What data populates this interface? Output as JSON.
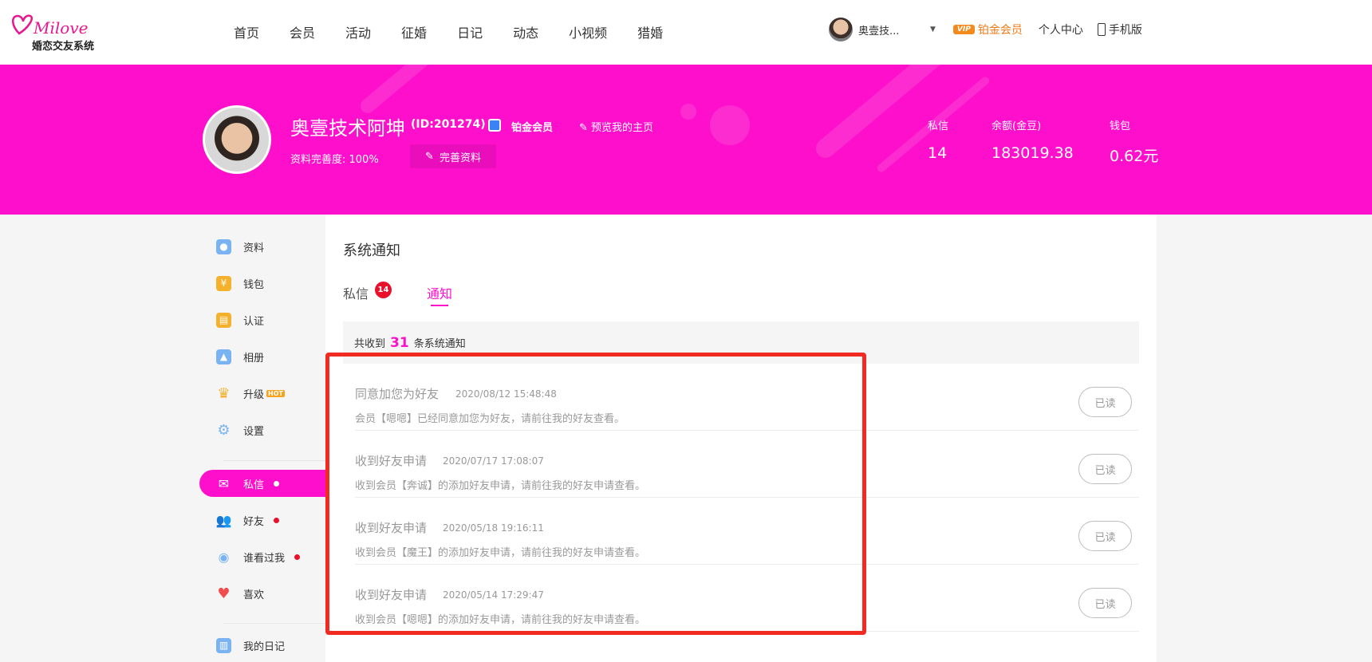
{
  "logo": {
    "script": "Milove",
    "subtitle": "婚恋交友系统"
  },
  "nav": [
    "首页",
    "会员",
    "活动",
    "征婚",
    "日记",
    "动态",
    "小视频",
    "猎婚"
  ],
  "user": {
    "name": "奥壹技...",
    "vip_badge": "VIP",
    "vip_level": "铂金会员",
    "center_link": "个人中心",
    "mobile_link": "手机版"
  },
  "profile": {
    "name": "奥壹技术阿坤",
    "id": "(ID:201274)",
    "member_label": "铂金会员",
    "preview_link": "预览我的主页",
    "completeness": "资料完善度: 100%",
    "edit_button": "完善资料"
  },
  "stats": [
    {
      "label": "私信",
      "value": "14"
    },
    {
      "label": "余额(金豆)",
      "value": "183019.38"
    },
    {
      "label": "钱包",
      "value": "0.62元"
    }
  ],
  "sidebar": {
    "items": [
      {
        "label": "资料",
        "icon": "profile-icon",
        "color": "#7ab3f2"
      },
      {
        "label": "钱包",
        "icon": "money-bag-icon",
        "color": "#f5b02c"
      },
      {
        "label": "认证",
        "icon": "certificate-icon",
        "color": "#f5b02c"
      },
      {
        "label": "相册",
        "icon": "album-icon",
        "color": "#7ab3f2"
      },
      {
        "label": "升级",
        "icon": "crown-icon",
        "color": "#f5b02c",
        "tag": "HOT"
      },
      {
        "label": "设置",
        "icon": "gear-icon",
        "color": "#7ab3f2"
      },
      {
        "label": "私信",
        "icon": "mail-icon",
        "color": "#ffffff",
        "active": true
      },
      {
        "label": "好友",
        "icon": "friends-icon",
        "color": "#7ab3f2"
      },
      {
        "label": "谁看过我",
        "icon": "eye-icon",
        "color": "#7ab3f2"
      },
      {
        "label": "喜欢",
        "icon": "heart-icon",
        "color": "#f24d4d"
      },
      {
        "label": "我的日记",
        "icon": "diary-icon",
        "color": "#7ab3f2"
      }
    ]
  },
  "main": {
    "title": "系统通知",
    "tabs": {
      "messages": "私信",
      "messages_badge": "14",
      "notices": "通知"
    },
    "summary_prefix": "共收到",
    "summary_count": "31",
    "summary_suffix": "条系统通知",
    "read_label": "已读",
    "notices": [
      {
        "title": "同意加您为好友",
        "time": "2020/08/12 15:48:48",
        "body": "会员【嗯嗯】已经同意加您为好友，请前往我的好友查看。"
      },
      {
        "title": "收到好友申请",
        "time": "2020/07/17 17:08:07",
        "body": "收到会员【奔诚】的添加好友申请，请前往我的好友申请查看。"
      },
      {
        "title": "收到好友申请",
        "time": "2020/05/18 19:16:11",
        "body": "收到会员【魔王】的添加好友申请，请前往我的好友申请查看。"
      },
      {
        "title": "收到好友申请",
        "time": "2020/05/14 17:29:47",
        "body": "收到会员【嗯嗯】的添加好友申请，请前往我的好友申请查看。"
      }
    ]
  },
  "colors": {
    "brand_pink": "#fd0fcb",
    "vip_orange": "#f07a14",
    "badge_red": "#e8102a",
    "highlight_red": "#f12b22"
  }
}
